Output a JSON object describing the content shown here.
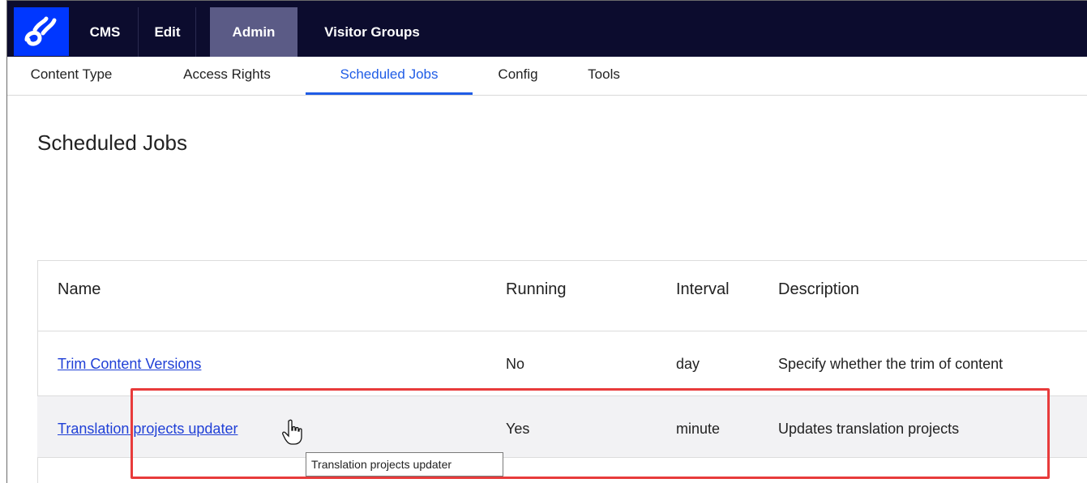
{
  "topnav": {
    "cms": "CMS",
    "edit": "Edit",
    "admin": "Admin",
    "visitor_groups": "Visitor Groups"
  },
  "subnav": {
    "content_type": "Content Type",
    "access_rights": "Access Rights",
    "scheduled_jobs": "Scheduled Jobs",
    "config": "Config",
    "tools": "Tools",
    "active": "Scheduled Jobs"
  },
  "page": {
    "title": "Scheduled Jobs"
  },
  "table": {
    "headers": [
      "Name",
      "Running",
      "Interval",
      "Description"
    ],
    "rows": [
      {
        "name": "Trim Content Versions",
        "running": "No",
        "interval": "day",
        "description": "Specify whether the trim of content"
      },
      {
        "name": "Translation projects updater",
        "running": "Yes",
        "interval": "minute",
        "description": "Updates translation projects"
      }
    ]
  },
  "tooltip": "Translation projects updater",
  "colors": {
    "topbar_bg": "#0c0c2e",
    "logo_bg": "#0037ff",
    "active_tab": "#1f5ce6",
    "link": "#1f3fd6",
    "highlight_border": "#e83b3b"
  },
  "icons": {
    "logo": "optimizely-logo-icon",
    "cursor": "hand-pointer-icon"
  }
}
